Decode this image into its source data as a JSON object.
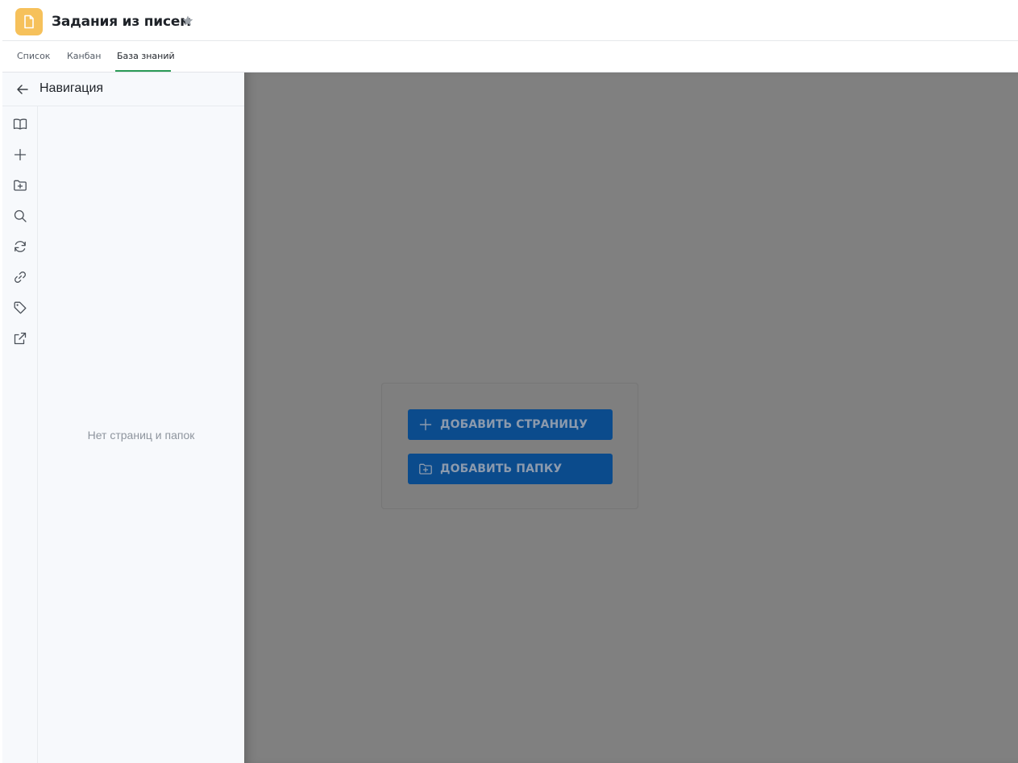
{
  "header": {
    "title": "Задания из писем",
    "icon": "document-icon",
    "icon_color": "#f6c15b",
    "favorite_icon": "star-icon"
  },
  "tabs": [
    {
      "label": "Список",
      "active": false
    },
    {
      "label": "Канбан",
      "active": false
    },
    {
      "label": "База знаний",
      "active": true
    }
  ],
  "accent": "#2b9a57",
  "navigation": {
    "title": "Навигация",
    "back_icon": "arrow-left-icon",
    "rail_icons": [
      "book-icon",
      "plus-icon",
      "folder-plus-icon",
      "search-icon",
      "refresh-icon",
      "link-icon",
      "tag-icon",
      "external-link-icon"
    ],
    "empty_text": "Нет страниц и папок"
  },
  "empty_state": {
    "add_page_label": "ДОБАВИТЬ СТРАНИЦУ",
    "add_folder_label": "ДОБАВИТЬ ПАПКУ",
    "button_color": "#0b4b8c"
  }
}
